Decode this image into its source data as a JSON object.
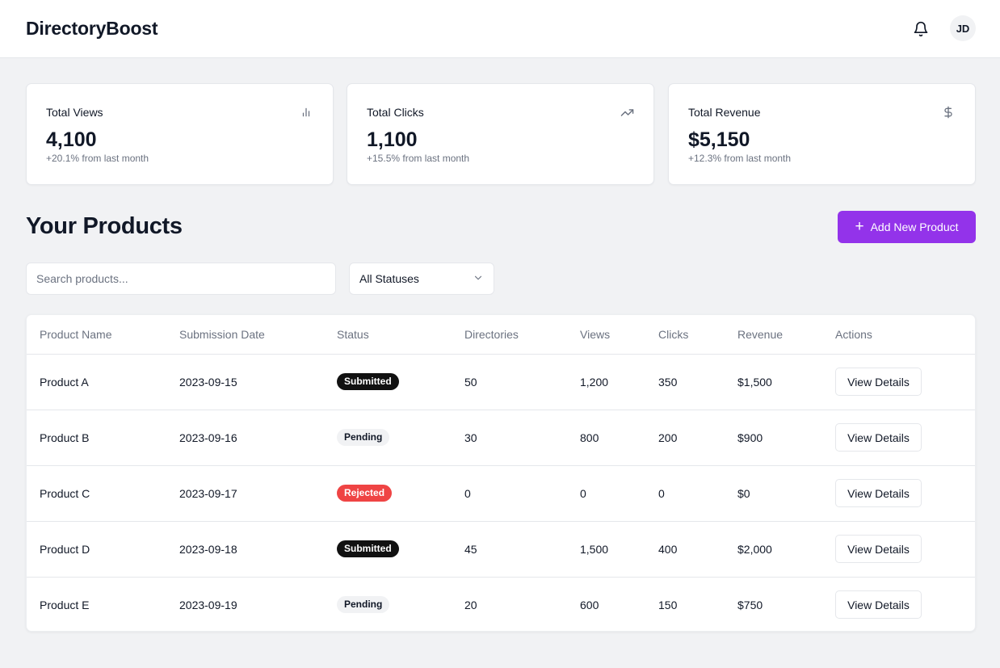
{
  "header": {
    "brand": "DirectoryBoost",
    "avatar_initials": "JD"
  },
  "stats": [
    {
      "title": "Total Views",
      "value": "4,100",
      "sub": "+20.1% from last month",
      "icon": "bar-chart-icon"
    },
    {
      "title": "Total Clicks",
      "value": "1,100",
      "sub": "+15.5% from last month",
      "icon": "trending-up-icon"
    },
    {
      "title": "Total Revenue",
      "value": "$5,150",
      "sub": "+12.3% from last month",
      "icon": "dollar-icon"
    }
  ],
  "products": {
    "title": "Your Products",
    "add_label": "Add New Product",
    "search_placeholder": "Search products...",
    "status_filter": "All Statuses",
    "columns": [
      "Product Name",
      "Submission Date",
      "Status",
      "Directories",
      "Views",
      "Clicks",
      "Revenue",
      "Actions"
    ],
    "rows": [
      {
        "name": "Product A",
        "date": "2023-09-15",
        "status": "Submitted",
        "directories": "50",
        "views": "1,200",
        "clicks": "350",
        "revenue": "$1,500",
        "action": "View Details"
      },
      {
        "name": "Product B",
        "date": "2023-09-16",
        "status": "Pending",
        "directories": "30",
        "views": "800",
        "clicks": "200",
        "revenue": "$900",
        "action": "View Details"
      },
      {
        "name": "Product C",
        "date": "2023-09-17",
        "status": "Rejected",
        "directories": "0",
        "views": "0",
        "clicks": "0",
        "revenue": "$0",
        "action": "View Details"
      },
      {
        "name": "Product D",
        "date": "2023-09-18",
        "status": "Submitted",
        "directories": "45",
        "views": "1,500",
        "clicks": "400",
        "revenue": "$2,000",
        "action": "View Details"
      },
      {
        "name": "Product E",
        "date": "2023-09-19",
        "status": "Pending",
        "directories": "20",
        "views": "600",
        "clicks": "150",
        "revenue": "$750",
        "action": "View Details"
      }
    ]
  },
  "colors": {
    "accent": "#9333ea",
    "submitted": "#111111",
    "pending": "#f1f2f4",
    "rejected": "#ef4444",
    "background": "#f1f2f4"
  }
}
